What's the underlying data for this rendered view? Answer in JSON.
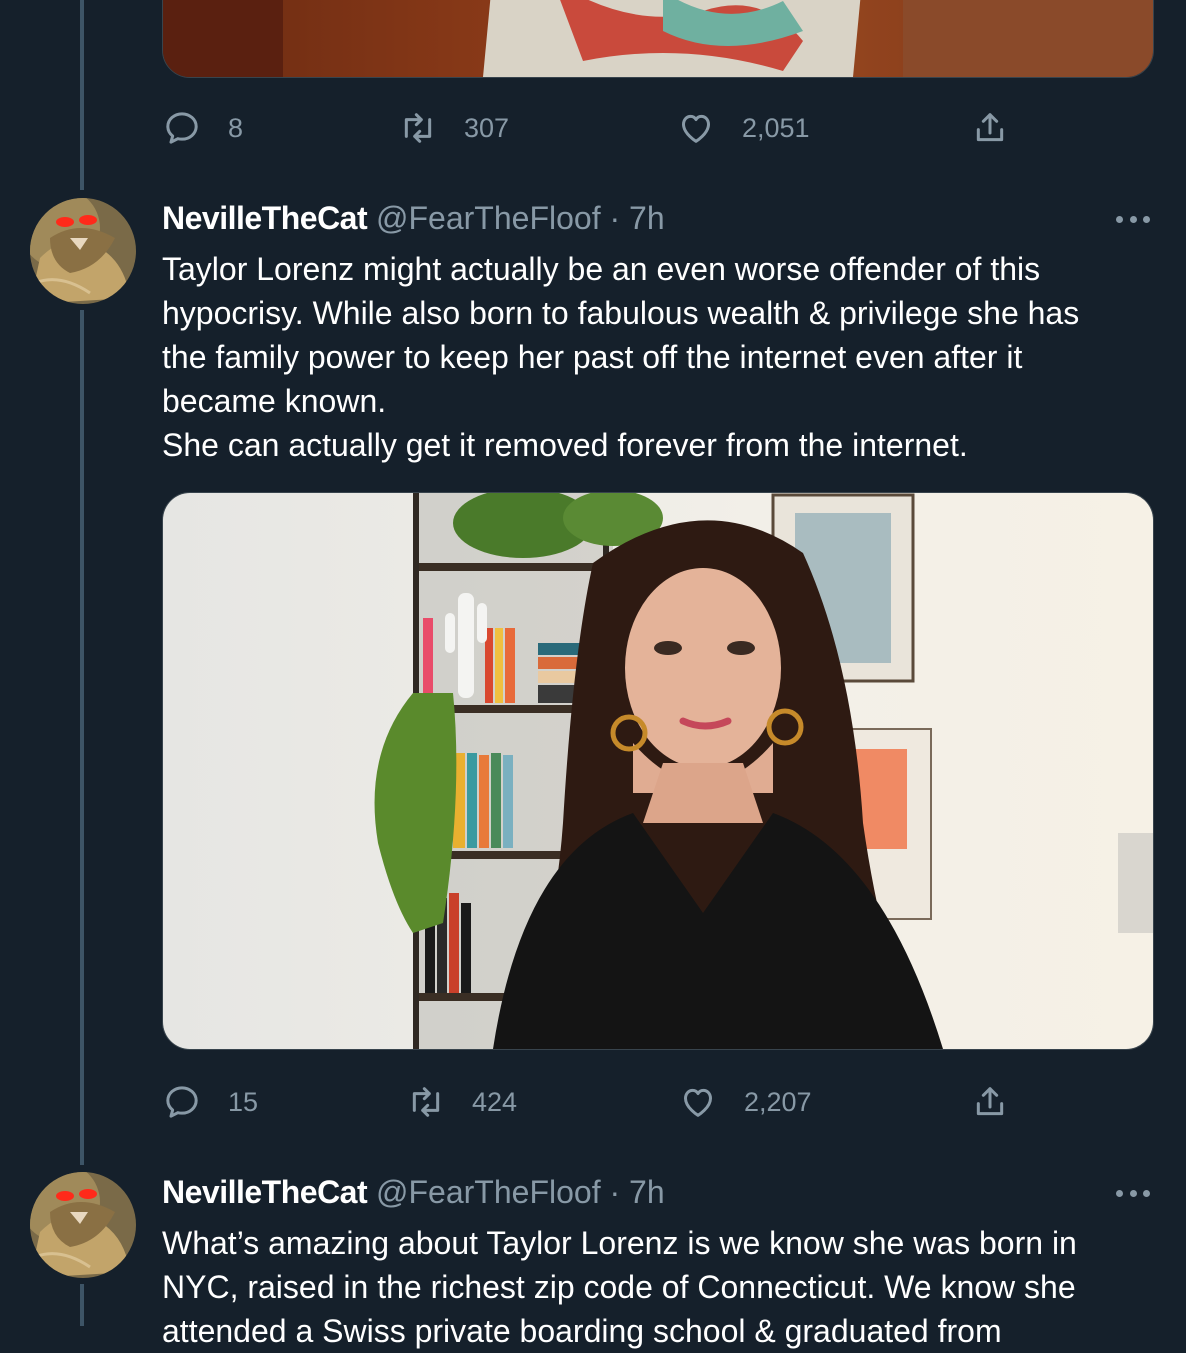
{
  "tweets": [
    {
      "stats": {
        "replies": "8",
        "retweets": "307",
        "likes": "2,051"
      }
    },
    {
      "author": {
        "name": "NevilleTheCat",
        "handle": "@FearTheFloof",
        "sep": "·",
        "time": "7h"
      },
      "text_lines": [
        "Taylor Lorenz might actually be an even worse offender of this",
        "hypocrisy. While also born to fabulous wealth & privilege she has",
        "the family power to keep her past off the internet even after it",
        "became known.",
        "She can actually get it removed forever from the internet."
      ],
      "stats": {
        "replies": "15",
        "retweets": "424",
        "likes": "2,207"
      }
    },
    {
      "author": {
        "name": "NevilleTheCat",
        "handle": "@FearTheFloof",
        "sep": "·",
        "time": "7h"
      },
      "text_lines": [
        "What’s amazing about Taylor Lorenz is we know she was born in",
        "NYC, raised in the richest zip code of Connecticut. We know she",
        "attended a Swiss private boarding school & graduated from"
      ]
    }
  ],
  "icons": [
    "reply-icon",
    "retweet-icon",
    "like-icon",
    "share-icon",
    "more-icon"
  ],
  "colors": {
    "background": "#15202b",
    "muted_text": "#8899a6",
    "border": "#38444d"
  }
}
